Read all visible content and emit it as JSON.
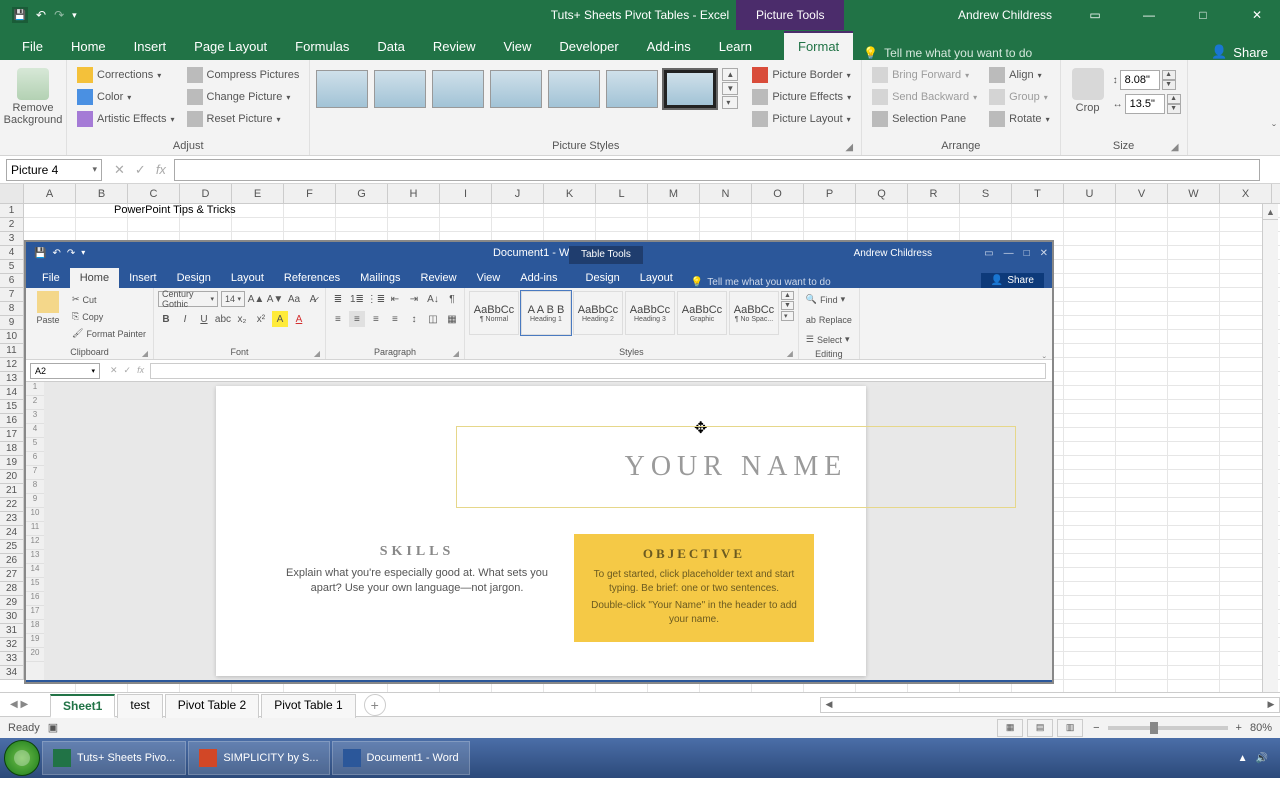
{
  "titlebar": {
    "title": "Tuts+ Sheets Pivot Tables - Excel",
    "tool_context": "Picture Tools",
    "user": "Andrew Childress"
  },
  "tabs": {
    "file": "File",
    "home": "Home",
    "insert": "Insert",
    "pagelayout": "Page Layout",
    "formulas": "Formulas",
    "data": "Data",
    "review": "Review",
    "view": "View",
    "developer": "Developer",
    "addins": "Add-ins",
    "learn": "Learn",
    "format": "Format",
    "tellme": "Tell me what you want to do",
    "share": "Share"
  },
  "ribbon": {
    "remove_bg": "Remove Background",
    "corrections": "Corrections",
    "color": "Color",
    "artistic": "Artistic Effects",
    "compress": "Compress Pictures",
    "change_pic": "Change Picture",
    "reset_pic": "Reset Picture",
    "adjust": "Adjust",
    "picture_styles": "Picture Styles",
    "pic_border": "Picture Border",
    "pic_effects": "Picture Effects",
    "pic_layout": "Picture Layout",
    "bring_fwd": "Bring Forward",
    "send_back": "Send Backward",
    "sel_pane": "Selection Pane",
    "align": "Align",
    "group_btn": "Group",
    "rotate": "Rotate",
    "arrange": "Arrange",
    "crop": "Crop",
    "size": "Size",
    "height": "8.08\"",
    "width": "13.5\""
  },
  "namebox": {
    "name": "Picture 4"
  },
  "columns": [
    "A",
    "B",
    "C",
    "D",
    "E",
    "F",
    "G",
    "H",
    "I",
    "J",
    "K",
    "L",
    "M",
    "N",
    "O",
    "P",
    "Q",
    "R",
    "S",
    "T",
    "U",
    "V",
    "W",
    "X"
  ],
  "rows": [
    "1",
    "2",
    "3",
    "4",
    "5",
    "6",
    "7",
    "8",
    "9",
    "10",
    "11",
    "12",
    "13",
    "14",
    "15",
    "16",
    "17",
    "18",
    "19",
    "20",
    "21",
    "22",
    "23",
    "24",
    "25",
    "26",
    "27",
    "28",
    "29",
    "30",
    "31",
    "32",
    "33",
    "34"
  ],
  "cellC1": "PowerPoint Tips & Tricks",
  "word": {
    "title": "Document1 - Word",
    "tool_context": "Table Tools",
    "user": "Andrew Childress",
    "tabs": {
      "file": "File",
      "home": "Home",
      "insert": "Insert",
      "design": "Design",
      "layout": "Layout",
      "references": "References",
      "mailings": "Mailings",
      "review": "Review",
      "view": "View",
      "addins": "Add-ins",
      "tdesign": "Design",
      "tlayout": "Layout",
      "tellme": "Tell me what you want to do",
      "share": "Share"
    },
    "clipboard": {
      "paste": "Paste",
      "cut": "Cut",
      "copy": "Copy",
      "painter": "Format Painter",
      "label": "Clipboard"
    },
    "font": {
      "name": "Century Gothic",
      "size": "14",
      "label": "Font"
    },
    "para": {
      "label": "Paragraph"
    },
    "styles": {
      "label": "Styles",
      "items": [
        {
          "prev": "AaBbCc",
          "name": "¶ Normal"
        },
        {
          "prev": "A A B B",
          "name": "Heading 1"
        },
        {
          "prev": "AaBbCc",
          "name": "Heading 2"
        },
        {
          "prev": "AaBbCc",
          "name": "Heading 3"
        },
        {
          "prev": "AaBbCc",
          "name": "Graphic"
        },
        {
          "prev": "AaBbCc",
          "name": "¶ No Spac..."
        }
      ]
    },
    "editing": {
      "find": "Find",
      "replace": "Replace",
      "select": "Select",
      "label": "Editing"
    },
    "namebox": "A2",
    "rows": [
      "1",
      "2",
      "3",
      "4",
      "5",
      "6",
      "7",
      "8",
      "9",
      "10",
      "11",
      "12",
      "13",
      "14",
      "15",
      "16",
      "17",
      "18",
      "19",
      "20"
    ],
    "doc": {
      "name": "YOUR NAME",
      "skills_h": "SKILLS",
      "skills_p": "Explain what you're especially good at. What sets you apart? Use your own language—not jargon.",
      "obj_h": "OBJECTIVE",
      "obj_p1": "To get started, click placeholder text and start typing. Be brief: one or two sentences.",
      "obj_p2": "Double-click \"Your Name\" in the header to add your name."
    }
  },
  "sheets": {
    "active": "Sheet1",
    "tabs": [
      "Sheet1",
      "test",
      "Pivot Table 2",
      "Pivot Table 1"
    ]
  },
  "status": {
    "ready": "Ready",
    "zoom": "80%"
  },
  "taskbar": {
    "excel": "Tuts+ Sheets Pivo...",
    "ppt": "SIMPLICITY by S...",
    "word": "Document1 - Word"
  }
}
